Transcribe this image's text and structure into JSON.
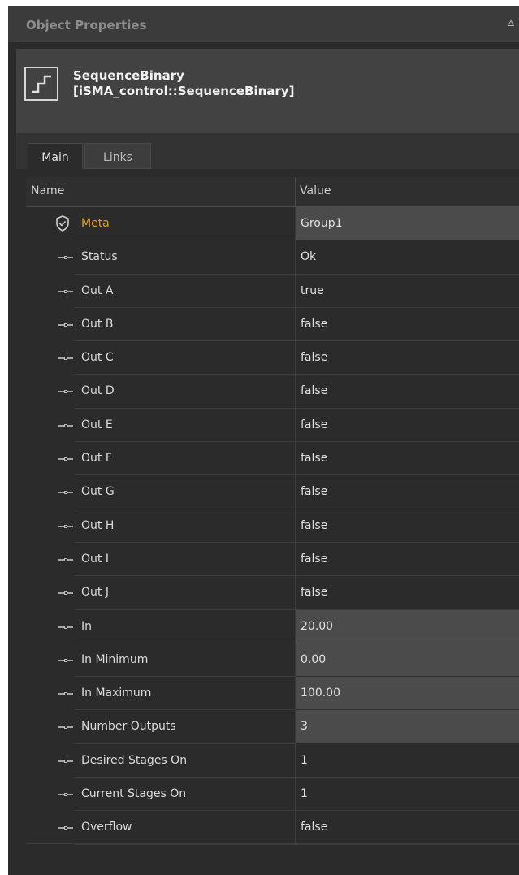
{
  "panel": {
    "title": "Object Properties",
    "pin": "⩟"
  },
  "object": {
    "name": "SequenceBinary",
    "type": "[iSMA_control::SequenceBinary]",
    "icon": "sequence-step-icon"
  },
  "tabs": [
    {
      "label": "Main",
      "active": true
    },
    {
      "label": "Links",
      "active": false
    }
  ],
  "grid": {
    "columns": {
      "name": "Name",
      "value": "Value"
    },
    "rows": [
      {
        "name": "Meta",
        "value": "Group1",
        "icon": "shield-icon",
        "editable": true
      },
      {
        "name": "Status",
        "value": "Ok",
        "icon": "slot-icon",
        "editable": false
      },
      {
        "name": "Out A",
        "value": "true",
        "icon": "slot-icon",
        "editable": false
      },
      {
        "name": "Out B",
        "value": "false",
        "icon": "slot-icon",
        "editable": false
      },
      {
        "name": "Out C",
        "value": "false",
        "icon": "slot-icon",
        "editable": false
      },
      {
        "name": "Out D",
        "value": "false",
        "icon": "slot-icon",
        "editable": false
      },
      {
        "name": "Out E",
        "value": "false",
        "icon": "slot-icon",
        "editable": false
      },
      {
        "name": "Out F",
        "value": "false",
        "icon": "slot-icon",
        "editable": false
      },
      {
        "name": "Out G",
        "value": "false",
        "icon": "slot-icon",
        "editable": false
      },
      {
        "name": "Out H",
        "value": "false",
        "icon": "slot-icon",
        "editable": false
      },
      {
        "name": "Out I",
        "value": "false",
        "icon": "slot-icon",
        "editable": false
      },
      {
        "name": "Out J",
        "value": "false",
        "icon": "slot-icon",
        "editable": false
      },
      {
        "name": "In",
        "value": "20.00",
        "icon": "slot-icon",
        "editable": true
      },
      {
        "name": "In Minimum",
        "value": "0.00",
        "icon": "slot-icon",
        "editable": true
      },
      {
        "name": "In Maximum",
        "value": "100.00",
        "icon": "slot-icon",
        "editable": true
      },
      {
        "name": "Number Outputs",
        "value": "3",
        "icon": "slot-icon",
        "editable": true
      },
      {
        "name": "Desired Stages On",
        "value": "1",
        "icon": "slot-icon",
        "editable": false
      },
      {
        "name": "Current Stages On",
        "value": "1",
        "icon": "slot-icon",
        "editable": false
      },
      {
        "name": "Overflow",
        "value": "false",
        "icon": "slot-icon",
        "editable": false
      }
    ]
  },
  "colors": {
    "meta_label": "#e0a526",
    "panel_bg": "#2b2b2b",
    "editable_value_bg": "#4b4b4b"
  }
}
